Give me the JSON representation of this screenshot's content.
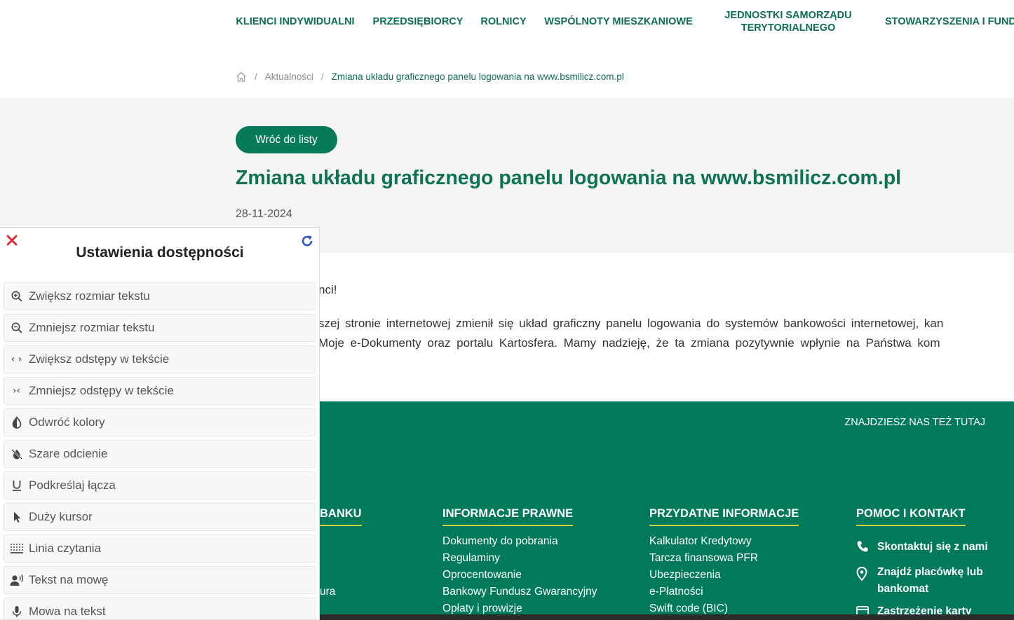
{
  "nav": {
    "items": [
      {
        "label": "KLIENCI INDYWIDUALNI"
      },
      {
        "label": "PRZEDSIĘBIORCY"
      },
      {
        "label": "ROLNICY"
      },
      {
        "label": "WSPÓLNOTY MIESZKANIOWE"
      },
      {
        "label": "JEDNOSTKI SAMORZĄDU TERYTORIALNEGO"
      },
      {
        "label": "STOWARZYSZENIA I FUNDA"
      }
    ]
  },
  "breadcrumb": {
    "home_icon": "home-icon",
    "separator": "/",
    "items": [
      {
        "label": "Aktualności"
      },
      {
        "label": "Zmiana układu graficznego panelu logowania na www.bsmilicz.com.pl"
      }
    ]
  },
  "article": {
    "back_label": "Wróć do listy",
    "title": "Zmiana układu graficznego panelu logowania na www.bsmilicz.com.pl",
    "date": "28-11-2024",
    "greeting": "nci!",
    "lines": [
      "szej stronie internetowej zmienił się układ graficzny panelu logowania do systemów bankowości internetowej, kan",
      "Moje e-Dokumenty oraz portalu Kartosfera. Mamy nadzieję, że ta zmiana pozytywnie wpłynie na Państwa kom"
    ]
  },
  "footer": {
    "find_us": "ZNAJDZIESZ NAS TEŻ TUTAJ",
    "columns": [
      {
        "title": "BANKU",
        "items": [
          "",
          "",
          "",
          "ura"
        ]
      },
      {
        "title": "INFORMACJE PRAWNE",
        "items": [
          "Dokumenty do pobrania",
          "Regulaminy",
          "Oprocentowanie",
          "Bankowy Fundusz Gwarancyjny",
          "Opłaty i prowizje"
        ]
      },
      {
        "title": "PRZYDATNE INFORMACJE",
        "items": [
          "Kalkulator Kredytowy",
          "Tarcza finansowa PFR",
          "Ubezpieczenia",
          "e-Płatności",
          "Swift code (BIC)"
        ]
      }
    ],
    "contact": {
      "title": "POMOC I KONTAKT",
      "items": [
        {
          "label": "Skontaktuj się z nami",
          "icon": "phone-icon"
        },
        {
          "label": "Znajdź placówkę lub bankomat",
          "icon": "location-pin-icon"
        },
        {
          "label": "Zastrzeżenie karty",
          "icon": "card-icon"
        }
      ]
    }
  },
  "accessibility": {
    "title": "Ustawienia dostępności",
    "close_icon": "close-icon",
    "reset_icon": "reset-icon",
    "items": [
      {
        "label": "Zwiększ rozmiar tekstu",
        "icon": "zoom-in-icon"
      },
      {
        "label": "Zmniejsz rozmiar tekstu",
        "icon": "zoom-out-icon"
      },
      {
        "label": "Zwiększ odstępy w tekście",
        "icon": "spacing-increase-icon"
      },
      {
        "label": "Zmniejsz odstępy w tekście",
        "icon": "spacing-decrease-icon"
      },
      {
        "label": "Odwróć kolory",
        "icon": "contrast-icon"
      },
      {
        "label": "Szare odcienie",
        "icon": "grayscale-icon"
      },
      {
        "label": "Podkreślaj łącza",
        "icon": "underline-icon"
      },
      {
        "label": "Duży kursor",
        "icon": "cursor-icon"
      },
      {
        "label": "Linia czytania",
        "icon": "reading-line-icon"
      },
      {
        "label": "Tekst na mowę",
        "icon": "text-to-speech-icon"
      },
      {
        "label": "Mowa na tekst",
        "icon": "speech-to-text-icon"
      }
    ]
  },
  "colors": {
    "brand_green": "#007a5b",
    "title_green": "#0e7355",
    "accent_yellow": "#d8cf3d",
    "close_red": "#d9262b",
    "reset_blue": "#2c55c9"
  }
}
